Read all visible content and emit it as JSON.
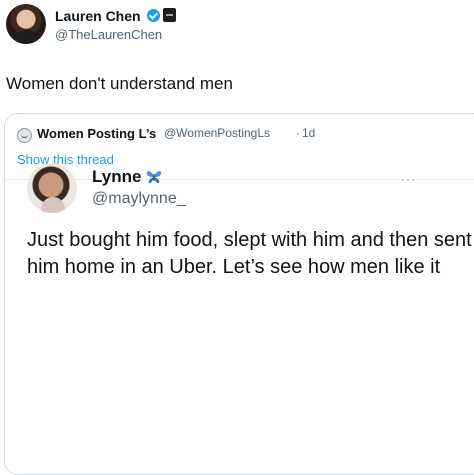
{
  "tweet": {
    "author": {
      "name": "Lauren Chen",
      "handle": "@TheLaurenChen",
      "verified": true
    },
    "text": "Women don't understand men",
    "quoted": {
      "author_name": "Women Posting L’s",
      "author_handle": "@WomenPostingLs",
      "separator": "·",
      "time": "1d",
      "show_thread_label": "Show this thread",
      "embedded_screenshot": {
        "author_name": "Lynne",
        "author_handle": "@maylynne_",
        "more_label": "···",
        "text": "Just bought him food, slept with him and then sent him home in an Uber. Let’s see how men like it"
      }
    }
  },
  "colors": {
    "link": "#1d9bf0",
    "verified": "#1d9bf0",
    "secondary_text": "#536471",
    "butterfly": "#4a90d9"
  },
  "icons": [
    "verified-badge-icon",
    "affiliate-badge-icon",
    "butterfly-icon",
    "more-options-icon"
  ]
}
